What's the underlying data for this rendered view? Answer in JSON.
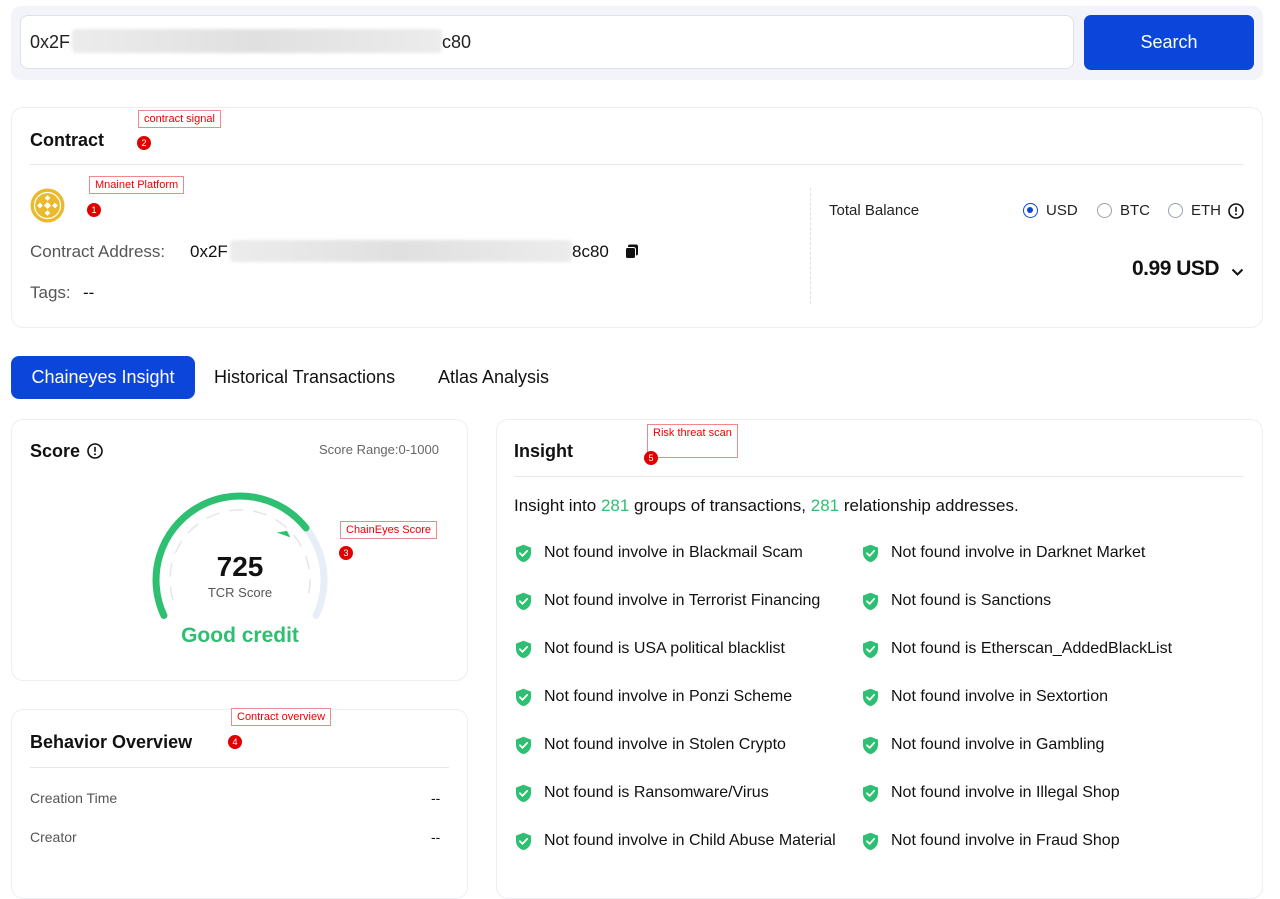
{
  "search": {
    "address_prefix": "0x2F",
    "address_suffix": "c80",
    "button_label": "Search"
  },
  "contract": {
    "title": "Contract",
    "address_label": "Contract Address:",
    "address_prefix": "0x2F",
    "address_suffix": "8c80",
    "tags_label": "Tags:",
    "tags_value": "--",
    "balance_label": "Total Balance",
    "currencies": [
      "USD",
      "BTC",
      "ETH"
    ],
    "selected_currency": "USD",
    "balance_value": "0.99 USD"
  },
  "annotations": {
    "a1": {
      "num": "1",
      "label": "Mnainet Platform"
    },
    "a2": {
      "num": "2",
      "label": "contract signal"
    },
    "a3": {
      "num": "3",
      "label": "ChainEyes Score"
    },
    "a4": {
      "num": "4",
      "label": "Contract overview"
    },
    "a5": {
      "num": "5",
      "label": "Risk threat scan"
    }
  },
  "tabs": [
    "Chaineyes Insight",
    "Historical Transactions",
    "Atlas Analysis"
  ],
  "score": {
    "title": "Score",
    "range": "Score Range:0-1000",
    "value": "725",
    "label": "TCR Score",
    "rating": "Good credit",
    "fraction": 0.725
  },
  "behavior": {
    "title": "Behavior Overview",
    "rows": [
      {
        "label": "Creation Time",
        "value": "--"
      },
      {
        "label": "Creator",
        "value": "--"
      }
    ]
  },
  "insight": {
    "title": "Insight",
    "summary_pre": "Insight into ",
    "groups": "281",
    "summary_mid": " groups of transactions, ",
    "addresses": "281",
    "summary_post": " relationship addresses.",
    "left": [
      "Not found involve in Blackmail Scam",
      "Not found involve in Terrorist Financing",
      "Not found is USA political blacklist",
      "Not found involve in Ponzi Scheme",
      "Not found involve in Stolen Crypto",
      "Not found is Ransomware/Virus",
      "Not found involve in Child Abuse Material"
    ],
    "right": [
      "Not found involve in Darknet Market",
      "Not found is Sanctions",
      "Not found is Etherscan_AddedBlackList",
      "Not found involve in Sextortion",
      "Not found involve in Gambling",
      "Not found involve in Illegal Shop",
      "Not found involve in Fraud Shop"
    ]
  },
  "colors": {
    "primary": "#0c45d9",
    "success": "#2fbf71"
  }
}
